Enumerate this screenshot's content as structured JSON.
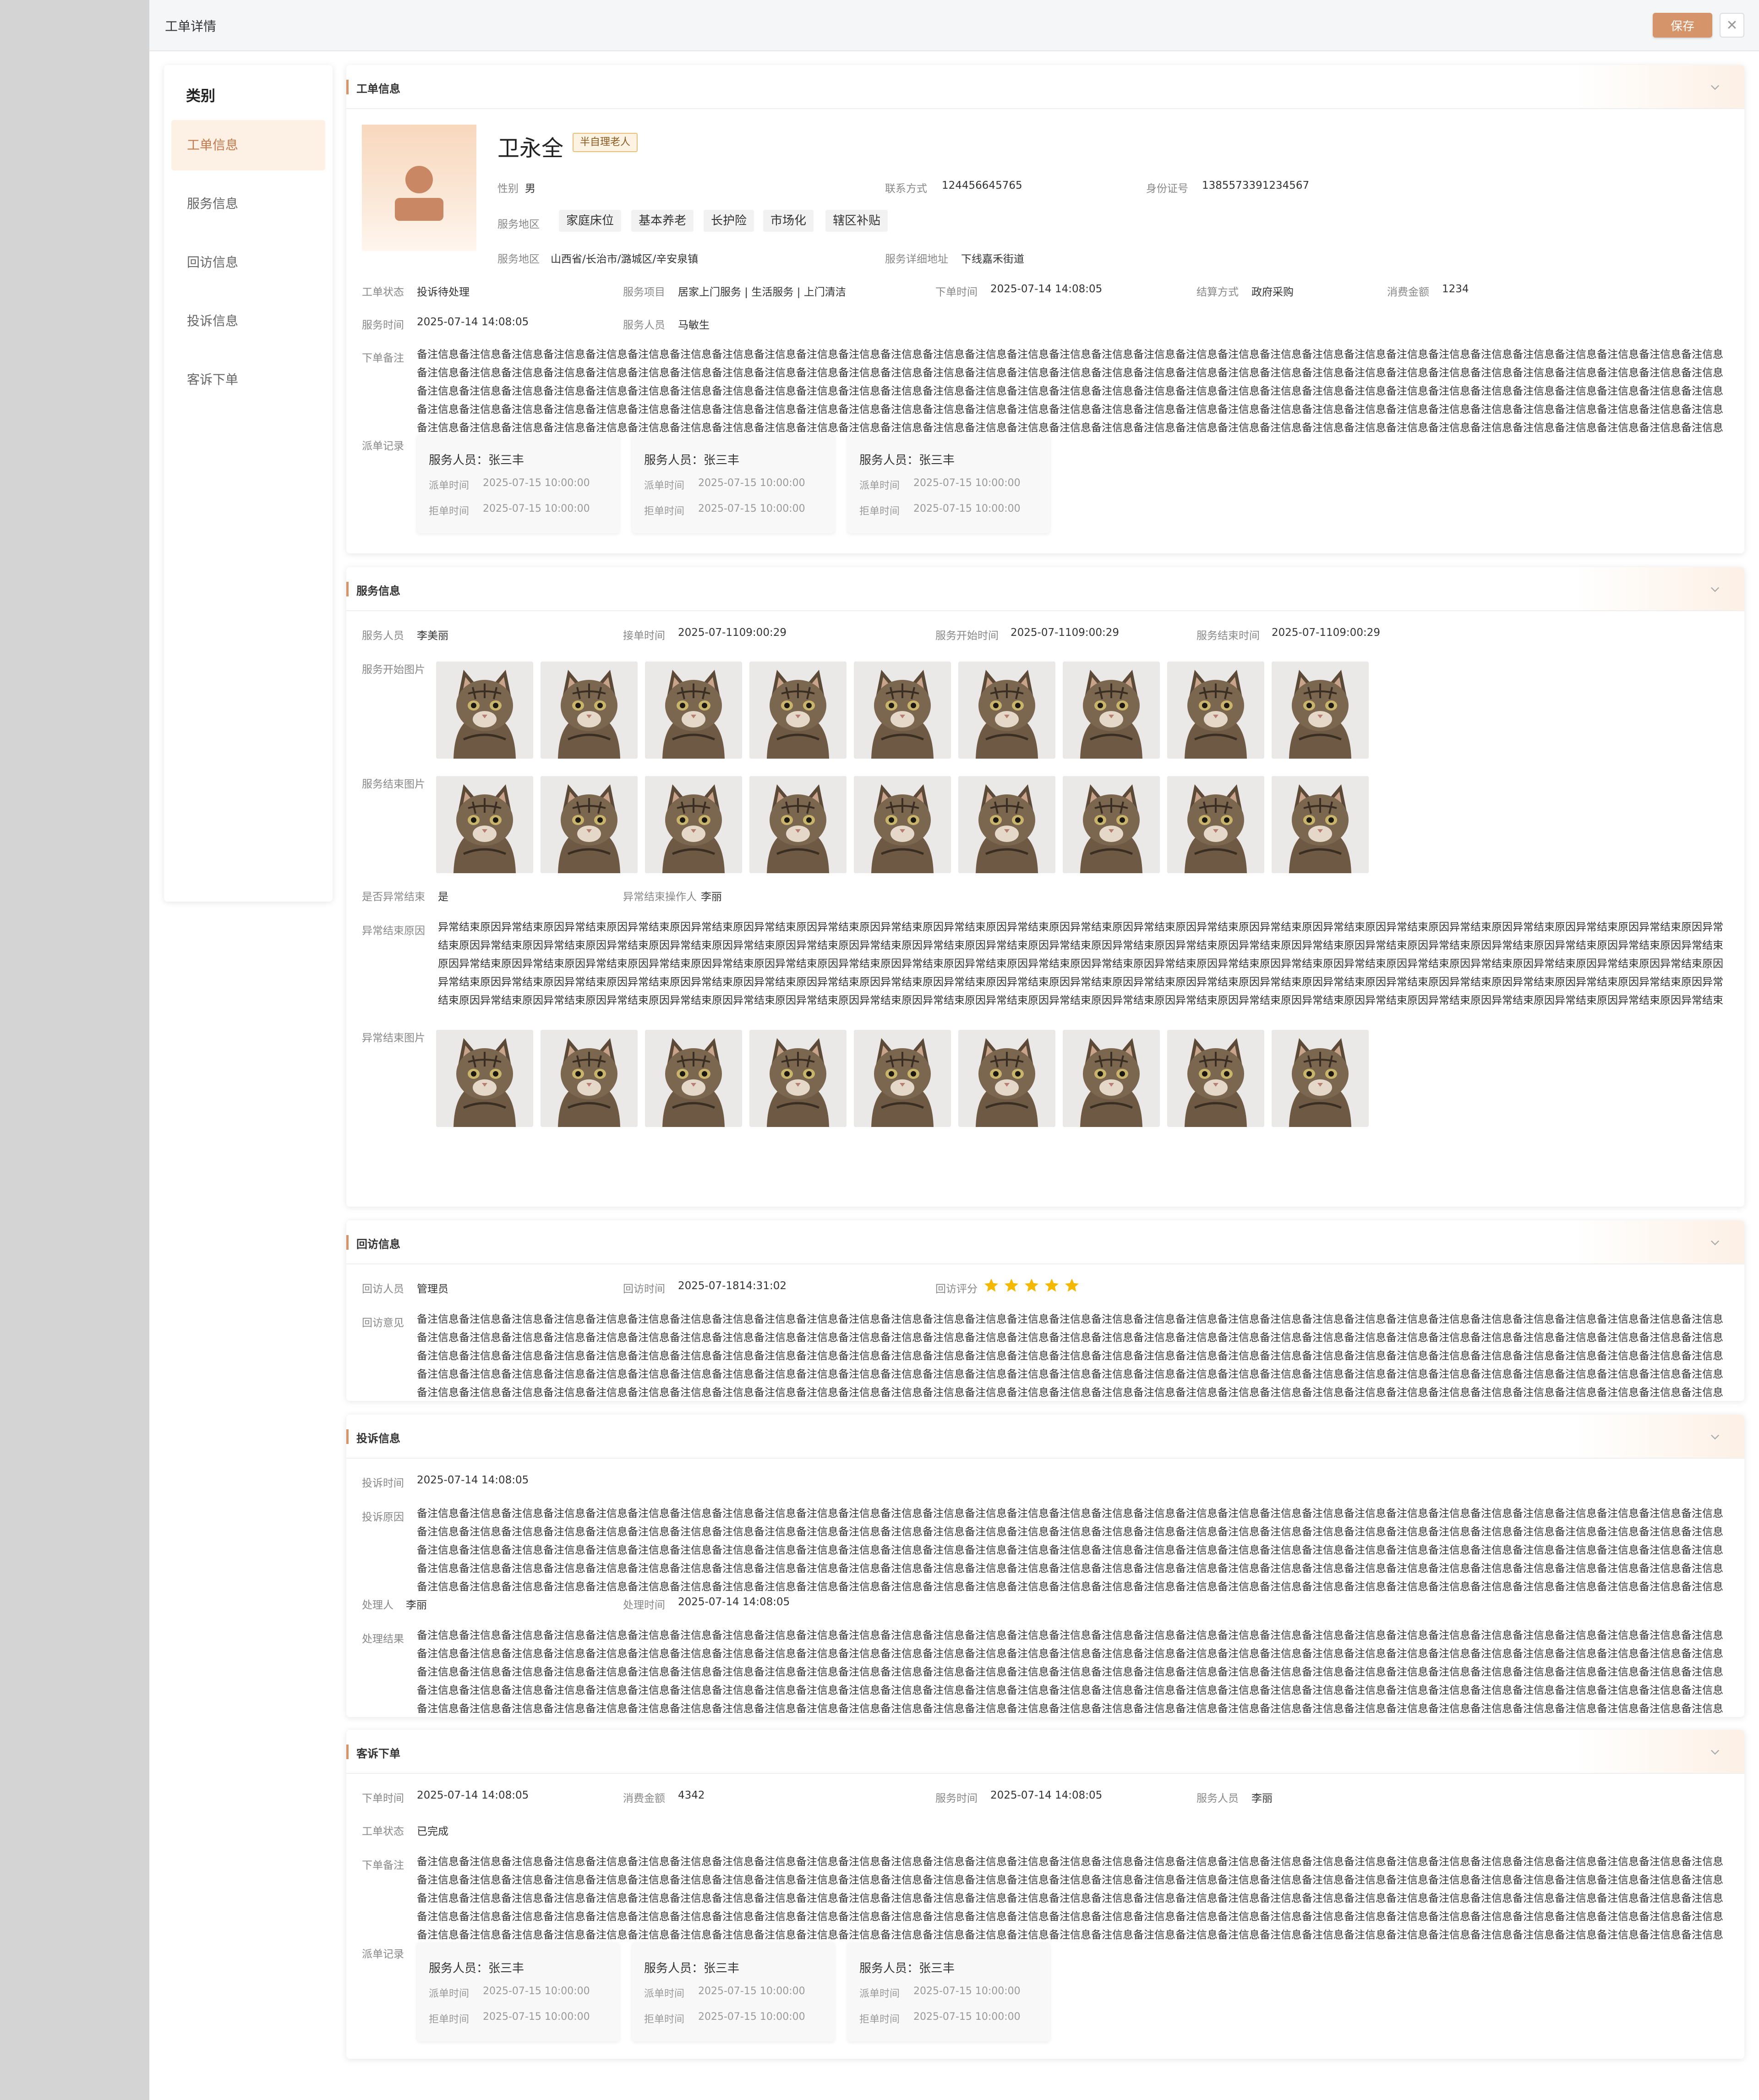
{
  "window": {
    "title": "工单详情",
    "save_label": "保存"
  },
  "sidebar": {
    "title": "类别",
    "items": [
      {
        "label": "工单信息",
        "active": true
      },
      {
        "label": "服务信息"
      },
      {
        "label": "回访信息"
      },
      {
        "label": "投诉信息"
      },
      {
        "label": "客诉下单"
      }
    ]
  },
  "order": {
    "title": "工单信息",
    "name": "卫永全",
    "badge": "半自理老人",
    "gender_label": "性别",
    "gender": "男",
    "contact_label": "联系方式",
    "contact": "124456645765",
    "id_label": "身份证号",
    "id": "1385573391234567",
    "area_label": "服务地区",
    "tags": [
      "家庭床位",
      "基本养老",
      "长护险",
      "市场化",
      "辖区补贴"
    ],
    "region_label": "服务地区",
    "region": "山西省/长治市/潞城区/辛安泉镇",
    "address_label": "服务详细地址",
    "address": "下线嘉禾街道",
    "status_label": "工单状态",
    "status": "投诉待处理",
    "item_label": "服务项目",
    "item": "居家上门服务 | 生活服务 | 上门清洁",
    "order_time_label": "下单时间",
    "order_time": "2025-07-14  14:08:05",
    "settle_label": "结算方式",
    "settle": "政府采购",
    "amount_label": "消费金额",
    "amount": "1234",
    "service_time_label": "服务时间",
    "service_time": "2025-07-14  14:08:05",
    "staff_label": "服务人员",
    "staff": "马敏生",
    "remark_label": "下单备注",
    "remark": "备注信息备注信息备注信息备注信息备注信息备注信息备注信息备注信息备注信息备注信息备注信息备注信息备注信息备注信息备注信息备注信息备注信息备注信息备注信息备注信息备注信息备注信息备注信息备注信息备注信息备注信息备注信息备注信息备注信息备注信息备注信息备注信息备注信息备注信息备注信息备注信息备注信息备注信息备注信息备注信息备注信息备注信息备注信息备注信息备注信息备注信息备注信息备注信息备注信息备注信息备注信息备注信息备注信息备注信息备注信息备注信息备注信息备注信息备注信息备注信息备注信息备注信息备注信息备注信息备注信息备注信息备注信息备注信息备注信息备注信息备注信息备注信息备注信息备注信息备注信息备注信息备注信息备注信息备注信息备注信息备注信息备注信息备注信息备注信息备注信息备注信息备注信息备注信息备注信息备注信息备注信息备注信息备注信息备注信息备注信息备注信息备注信息备注信息备注信息备注信息备注信息备注信息备注信息备注信息备注信息备注信息备注信息备注信息备注信息备注信息备注信息备注信息备注信息备注信息备注信息备注信息备注信息备注信息备注信息备注信息备注信息备注信息备注信息备注信息备注信息备注信息备注信息备注信息备注信息备注信息备注信息备注信息备注信息备注信息备注信息备注信息备注信息备注信息备注信息备注信息备注信息备注信息备注信息备注信息备注信息备注信息备注信息备注信息备注信息备注信息备注信息备注信息备注信息备注信息备注信息备注信息备注信息备注信息备注信息备注信息备注信息备注信息备注信息备注信息备注信息备注信息备注信息备注信息备注信息备注信息备注信息备注信息备注信息备注信息备注信息备注信息备注信息备注信息备注信息备注信息备注信息备注信息备注信息备注信息备注信息备注信息备注信息备注信息备注信息备注信息备注信息备注信息备注信息备注信息备注信息备注信息备注信息备注信息备注信息备注信息备注信息备注信息备注信息备注信息备注信息备注信息备注信息备注信息备注信息备注信息备注信息备注信息备注信息备注信息备注信息备注信息备注信息备注信息备注信息备注信息备注信息备注信息备注信息备注信息备注信息备注信息备注信息备注",
    "record_label": "派单记录",
    "records": [
      {
        "name": "服务人员：张三丰",
        "dispatch_label": "派单时间",
        "dispatch": "2025-07-15 10:00:00",
        "reject_label": "拒单时间",
        "reject": "2025-07-15 10:00:00"
      },
      {
        "name": "服务人员：张三丰",
        "dispatch_label": "派单时间",
        "dispatch": "2025-07-15 10:00:00",
        "reject_label": "拒单时间",
        "reject": "2025-07-15 10:00:00"
      },
      {
        "name": "服务人员：张三丰",
        "dispatch_label": "派单时间",
        "dispatch": "2025-07-15 10:00:00",
        "reject_label": "拒单时间",
        "reject": "2025-07-15 10:00:00"
      }
    ]
  },
  "service": {
    "title": "服务信息",
    "staff_label": "服务人员",
    "staff": "李美丽",
    "accept_label": "接单时间",
    "accept": "2025-07-1109:00:29",
    "start_label": "服务开始时间",
    "start": "2025-07-1109:00:29",
    "end_label": "服务结束时间",
    "end": "2025-07-1109:00:29",
    "start_img_label": "服务开始图片",
    "end_img_label": "服务结束图片",
    "abnormal_label": "是否异常结束",
    "abnormal": "是",
    "operator_label": "异常结束操作人",
    "operator": "李丽",
    "reason_label": "异常结束原因",
    "reason": "异常结束原因异常结束原因异常结束原因异常结束原因异常结束原因异常结束原因异常结束原因异常结束原因异常结束原因异常结束原因异常结束原因异常结束原因异常结束原因异常结束原因异常结束原因异常结束原因异常结束原因异常结束原因异常结束原因异常结束原因异常结束原因异常结束原因异常结束原因异常结束原因异常结束原因异常结束原因异常结束原因异常结束原因异常结束原因异常结束原因异常结束原因异常结束原因异常结束原因异常结束原因异常结束原因异常结束原因异常结束原因异常结束原因异常结束原因异常结束原因异常结束原因异常结束原因异常结束原因异常结束原因异常结束原因异常结束原因异常结束原因异常结束原因异常结束原因异常结束原因异常结束原因异常结束原因异常结束原因异常结束原因异常结束原因异常结束原因异常结束原因异常结束原因异常结束原因异常结束原因异常结束原因异常结束原因异常结束原因异常结束原因异常结束原因异常结束原因异常结束原因异常结束原因异常结束原因异常结束原因异常结束原因异常结束原因异常结束原因异常结束原因异常结束原因异常结束原因异常结束原因异常结束原因异常结束原因异常结束原因异常结束原因异常结束原因异常结束原因异常结束原因异常结束原因异常结束原因异常结束原因异常结束原因异常结束原因异常结束原因异常结束原因异常结束原因异常结束原因异常结束原因异常结束原因异常结束原因异常结束原因异常结束原因异常结束原因异常结束原因异常结束原因异常结束原因",
    "abnormal_img_label": "异常结束图片"
  },
  "revisit": {
    "title": "回访信息",
    "person_label": "回访人员",
    "person": "管理员",
    "time_label": "回访时间",
    "time": "2025-07-1814:31:02",
    "rating_label": "回访评分",
    "rating": 5,
    "opinion_label": "回访意见",
    "opinion": "备注信息备注信息备注信息备注信息备注信息备注信息备注信息备注信息备注信息备注信息备注信息备注信息备注信息备注信息备注信息备注信息备注信息备注信息备注信息备注信息备注信息备注信息备注信息备注信息备注信息备注信息备注信息备注信息备注信息备注信息备注信息备注信息备注信息备注信息备注信息备注信息备注信息备注信息备注信息备注信息备注信息备注信息备注信息备注信息备注信息备注信息备注信息备注信息备注信息备注信息备注信息备注信息备注信息备注信息备注信息备注信息备注信息备注信息备注信息备注信息备注信息备注信息备注信息备注信息备注信息备注信息备注信息备注信息备注信息备注信息备注信息备注信息备注信息备注信息备注信息备注信息备注信息备注信息备注信息备注信息备注信息备注信息备注信息备注信息备注信息备注信息备注信息备注信息备注信息备注信息备注信息备注信息备注信息备注信息备注信息备注信息备注信息备注信息备注信息备注信息备注信息备注信息备注信息备注信息备注信息备注信息备注信息备注信息备注信息备注信息备注信息备注信息备注信息备注信息备注信息备注信息备注信息备注信息备注信息备注信息备注信息备注信息备注信息备注信息备注信息备注信息备注信息备注信息备注信息备注信息备注信息备注信息备注信息备注信息备注信息备注信息备注信息备注信息备注信息备注信息备注信息备注信息备注信息备注信息备注信息备注信息备注信息备注信息备注信息备注信息备注信息备注信息备注信息备注信息备注信息备注信息备注信息备注信息备注信息备注信息备注信息备注信息备注信息备注信息备注信息备注信息备注信息备注信息备注信息备注信息备注信息备注信息备注信息备注信息备注信息备注信息备注信息备注信息备注信息备注信息备注信息备注信息备注信息备注信息备注信息备注信息备注信息备注信息备注信息备注信息备注信息备注信息备注信息备注信息备注信息备注信息备注信息备注信息备注信息备注信息备注信息备注信息备注信息备注信息备注信息备注信息备注信息备注信息备注信息备注信息备注"
  },
  "complaint": {
    "title": "投诉信息",
    "time_label": "投诉时间",
    "time": "2025-07-14  14:08:05",
    "reason_label": "投诉原因",
    "reason": "备注信息备注信息备注信息备注信息备注信息备注信息备注信息备注信息备注信息备注信息备注信息备注信息备注信息备注信息备注信息备注信息备注信息备注信息备注信息备注信息备注信息备注信息备注信息备注信息备注信息备注信息备注信息备注信息备注信息备注信息备注信息备注信息备注信息备注信息备注信息备注信息备注信息备注信息备注信息备注信息备注信息备注信息备注信息备注信息备注信息备注信息备注信息备注信息备注信息备注信息备注信息备注信息备注信息备注信息备注信息备注信息备注信息备注信息备注信息备注信息备注信息备注信息备注信息备注信息备注信息备注信息备注信息备注信息备注信息备注信息备注信息备注信息备注信息备注信息备注信息备注信息备注信息备注信息备注信息备注信息备注信息备注信息备注信息备注信息备注信息备注信息备注信息备注信息备注信息备注信息备注信息备注信息备注信息备注信息备注信息备注信息备注信息备注信息备注信息备注信息备注信息备注信息备注信息备注信息备注信息备注信息备注信息备注信息备注信息备注信息备注信息备注信息备注信息备注信息备注信息备注信息备注信息备注信息备注信息备注信息备注信息备注信息备注信息备注信息备注信息备注信息备注信息备注信息备注信息备注信息备注信息备注信息备注信息备注信息备注信息备注信息备注信息备注信息备注信息备注信息备注信息备注信息备注信息备注信息备注信息备注信息备注信息备注信息备注信息备注信息备注信息备注信息备注信息备注信息备注信息备注信息备注信息备注信息备注信息备注信息备注信息备注信息备注信息备注信息备注信息备注信息备注信息备注信息备注信息备注信息备注信息备注信息备注信息备注信息备注信息备注信息备注信息备注信息备注信息备注信息备注信息备注信息备注信息备注信息备注信息备注信息备注信息备注信息备注信息备注信息备注信息备注信息备注信息备注信息备注信息备注信息备注信息备注信息备注信息备注信息备注信息备注信息备注信息备注信息备注信息备注信息备注信息备注",
    "handler_label": "处理人",
    "handler": "李丽",
    "handle_time_label": "处理时间",
    "handle_time": "2025-07-14  14:08:05",
    "result_label": "处理结果",
    "result": "备注信息备注信息备注信息备注信息备注信息备注信息备注信息备注信息备注信息备注信息备注信息备注信息备注信息备注信息备注信息备注信息备注信息备注信息备注信息备注信息备注信息备注信息备注信息备注信息备注信息备注信息备注信息备注信息备注信息备注信息备注信息备注信息备注信息备注信息备注信息备注信息备注信息备注信息备注信息备注信息备注信息备注信息备注信息备注信息备注信息备注信息备注信息备注信息备注信息备注信息备注信息备注信息备注信息备注信息备注信息备注信息备注信息备注信息备注信息备注信息备注信息备注信息备注信息备注信息备注信息备注信息备注信息备注信息备注信息备注信息备注信息备注信息备注信息备注信息备注信息备注信息备注信息备注信息备注信息备注信息备注信息备注信息备注信息备注信息备注信息备注信息备注信息备注信息备注信息备注信息备注信息备注信息备注信息备注信息备注信息备注信息备注信息备注信息备注信息备注信息备注信息备注信息备注信息备注信息备注信息备注信息备注信息备注信息备注信息备注信息备注信息备注信息备注信息备注信息备注信息备注信息备注信息备注信息备注信息备注信息备注信息备注信息备注信息备注信息备注信息备注信息备注信息备注信息备注信息备注信息备注信息备注信息备注信息备注信息备注信息备注信息备注信息备注信息备注信息备注信息备注信息备注信息备注信息备注信息备注信息备注信息备注信息备注信息备注信息备注信息备注信息备注信息备注信息备注信息备注信息备注信息备注信息备注信息备注信息备注信息备注信息备注信息备注信息备注信息备注信息备注信息备注信息备注信息备注信息备注信息备注信息备注信息备注信息备注信息备注信息备注信息备注信息备注信息备注信息备注信息备注信息备注信息备注信息备注信息备注信息备注信息备注信息备注信息备注信息备注信息备注信息备注信息备注信息备注信息备注信息备注信息备注信息备注信息备注信息备注信息备注信息备注信息备注信息备注"
  },
  "customer_order": {
    "title": "客诉下单",
    "order_time_label": "下单时间",
    "order_time": "2025-07-14  14:08:05",
    "amount_label": "消费金额",
    "amount": "4342",
    "service_time_label": "服务时间",
    "service_time": "2025-07-14  14:08:05",
    "staff_label": "服务人员",
    "staff": "李丽",
    "status_label": "工单状态",
    "status": "已完成",
    "remark_label": "下单备注",
    "remark": "备注信息备注信息备注信息备注信息备注信息备注信息备注信息备注信息备注信息备注信息备注信息备注信息备注信息备注信息备注信息备注信息备注信息备注信息备注信息备注信息备注信息备注信息备注信息备注信息备注信息备注信息备注信息备注信息备注信息备注信息备注信息备注信息备注信息备注信息备注信息备注信息备注信息备注信息备注信息备注信息备注信息备注信息备注信息备注信息备注信息备注信息备注信息备注信息备注信息备注信息备注信息备注信息备注信息备注信息备注信息备注信息备注信息备注信息备注信息备注信息备注信息备注信息备注信息备注信息备注信息备注信息备注信息备注信息备注信息备注信息备注信息备注信息备注信息备注信息备注信息备注信息备注信息备注信息备注信息备注信息备注信息备注信息备注信息备注信息备注信息备注信息备注信息备注信息备注信息备注信息备注信息备注信息备注信息备注信息备注信息备注信息备注信息备注信息备注信息备注信息备注信息备注信息备注信息备注信息备注信息备注信息备注信息备注信息备注信息备注信息备注信息备注信息备注信息备注信息备注信息备注信息备注信息备注信息备注信息备注信息备注信息备注信息备注信息备注信息备注信息备注信息备注信息备注信息备注信息备注信息备注信息备注信息备注信息备注信息备注信息备注信息备注信息备注信息备注信息备注信息备注信息备注信息备注信息备注信息备注信息备注信息备注信息备注信息备注信息备注信息备注信息备注信息备注信息备注信息备注信息备注信息备注信息备注信息备注信息备注信息备注信息备注信息备注信息备注信息备注信息备注信息备注信息备注信息备注信息备注信息备注信息备注信息备注信息备注信息备注信息备注信息备注信息备注信息备注信息备注信息备注信息备注信息备注信息备注信息备注信息备注信息备注信息备注信息备注信息备注信息备注信息备注信息备注信息备注信息备注信息备注信息备注信息备注信息备注信息备注信息备注信息备注信息备注信息备注信息备注信息备注信息备注信息备注",
    "record_label": "派单记录",
    "records": [
      {
        "name": "服务人员：张三丰",
        "dispatch_label": "派单时间",
        "dispatch": "2025-07-15 10:00:00",
        "reject_label": "拒单时间",
        "reject": "2025-07-15 10:00:00"
      },
      {
        "name": "服务人员：张三丰",
        "dispatch_label": "派单时间",
        "dispatch": "2025-07-15 10:00:00",
        "reject_label": "拒单时间",
        "reject": "2025-07-15 10:00:00"
      },
      {
        "name": "服务人员：张三丰",
        "dispatch_label": "派单时间",
        "dispatch": "2025-07-15 10:00:00",
        "reject_label": "拒单时间",
        "reject": "2025-07-15 10:00:00"
      }
    ]
  },
  "icons": {
    "collapse": "chevron-down-icon",
    "close": "close-icon",
    "avatar": "user-icon",
    "star": "star-icon",
    "photo": "cat-photo"
  },
  "colors": {
    "accent": "#d6946a",
    "active_bg": "#fdf0e5",
    "star": "#f5b800",
    "badge_border": "#e8c07a"
  }
}
